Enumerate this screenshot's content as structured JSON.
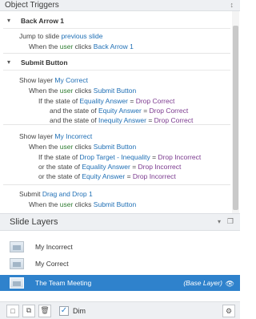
{
  "object_triggers": {
    "title": "Object Triggers",
    "groups": [
      {
        "title": "Back Arrow 1",
        "triggers": [
          {
            "action_prefix": "Jump to slide ",
            "action_target": "previous slide",
            "when_prefix": "When the ",
            "when_user": "user",
            "when_mid": " clicks ",
            "when_object": "Back Arrow 1"
          }
        ]
      },
      {
        "title": "Submit Button",
        "triggers": [
          {
            "action_prefix": "Show layer ",
            "action_target": "My Correct",
            "when_prefix": "When the ",
            "when_user": "user",
            "when_mid": " clicks ",
            "when_object": "Submit Button",
            "conditions": [
              {
                "prefix": "If the state of ",
                "var": "Equality Answer",
                "op": " = ",
                "val": "Drop Correct"
              },
              {
                "prefix": "and the state of ",
                "var": "Equity Answer",
                "op": " = ",
                "val": "Drop Correct"
              },
              {
                "prefix": "and the state of ",
                "var": "Inequity Answer",
                "op": " = ",
                "val": "Drop Correct"
              }
            ]
          },
          {
            "action_prefix": "Show layer ",
            "action_target": "My Incorrect",
            "when_prefix": "When the ",
            "when_user": "user",
            "when_mid": " clicks ",
            "when_object": "Submit Button",
            "conditions": [
              {
                "prefix": "If the state of ",
                "var": "Drop Target - Inequality",
                "op": " = ",
                "val": "Drop Incorrect"
              },
              {
                "prefix": "or the state of ",
                "var": "Equality Answer",
                "op": " = ",
                "val": "Drop Incorrect"
              },
              {
                "prefix": "or the state of ",
                "var": "Equity Answer",
                "op": " = ",
                "val": "Drop Incorrect"
              }
            ]
          },
          {
            "action_prefix": "Submit ",
            "action_target": "Drag and Drop 1",
            "when_prefix": "When the ",
            "when_user": "user",
            "when_mid": " clicks ",
            "when_object": "Submit Button"
          }
        ]
      }
    ]
  },
  "slide_layers": {
    "title": "Slide Layers",
    "layers": [
      {
        "name": "My Incorrect"
      },
      {
        "name": "My Correct"
      },
      {
        "name": "The Team Meeting",
        "tag": "(Base Layer)",
        "selected": true
      }
    ],
    "dim_label": "Dim",
    "dim_checked": true
  },
  "colors": {
    "accent": "#2f82cc",
    "link": "#1f6fb5",
    "user": "#2f7d32",
    "value": "#7b3a8f"
  }
}
